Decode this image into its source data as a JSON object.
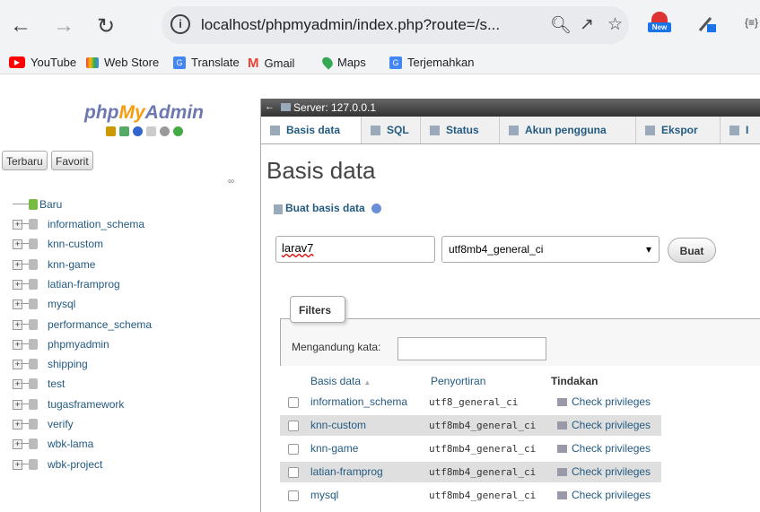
{
  "browser": {
    "url": "localhost/phpmyadmin/index.php?route=/s...",
    "new_badge": "New",
    "bookmarks": [
      "YouTube",
      "Web Store",
      "Translate",
      "Gmail",
      "Maps",
      "Terjemahkan"
    ]
  },
  "sidebar": {
    "logo_php": "php",
    "logo_my": "My",
    "logo_admin": "Admin",
    "btn_recent": "Terbaru",
    "btn_favorite": "Favorit",
    "new_item": "Baru",
    "databases": [
      "information_schema",
      "knn-custom",
      "knn-game",
      "latian-framprog",
      "mysql",
      "performance_schema",
      "phpmyadmin",
      "shipping",
      "test",
      "tugasframework",
      "verify",
      "wbk-lama",
      "wbk-project"
    ]
  },
  "main": {
    "server_label": "Server: 127.0.0.1",
    "tabs": [
      "Basis data",
      "SQL",
      "Status",
      "Akun pengguna",
      "Ekspor",
      "I"
    ],
    "page_title": "Basis data",
    "create_label": "Buat basis data",
    "db_name_value": "larav7",
    "collation_value": "utf8mb4_general_ci",
    "create_button": "Buat",
    "filters_legend": "Filters",
    "filter_label": "Mengandung kata:",
    "table": {
      "headers": [
        "Basis data",
        "Penyortiran",
        "Tindakan"
      ],
      "sort_indicator": "▲",
      "rows": [
        {
          "name": "information_schema",
          "collation": "utf8_general_ci",
          "action": "Check privileges"
        },
        {
          "name": "knn-custom",
          "collation": "utf8mb4_general_ci",
          "action": "Check privileges"
        },
        {
          "name": "knn-game",
          "collation": "utf8mb4_general_ci",
          "action": "Check privileges"
        },
        {
          "name": "latian-framprog",
          "collation": "utf8mb4_general_ci",
          "action": "Check privileges"
        },
        {
          "name": "mysql",
          "collation": "utf8mb4_general_ci",
          "action": "Check privileges"
        }
      ]
    }
  }
}
